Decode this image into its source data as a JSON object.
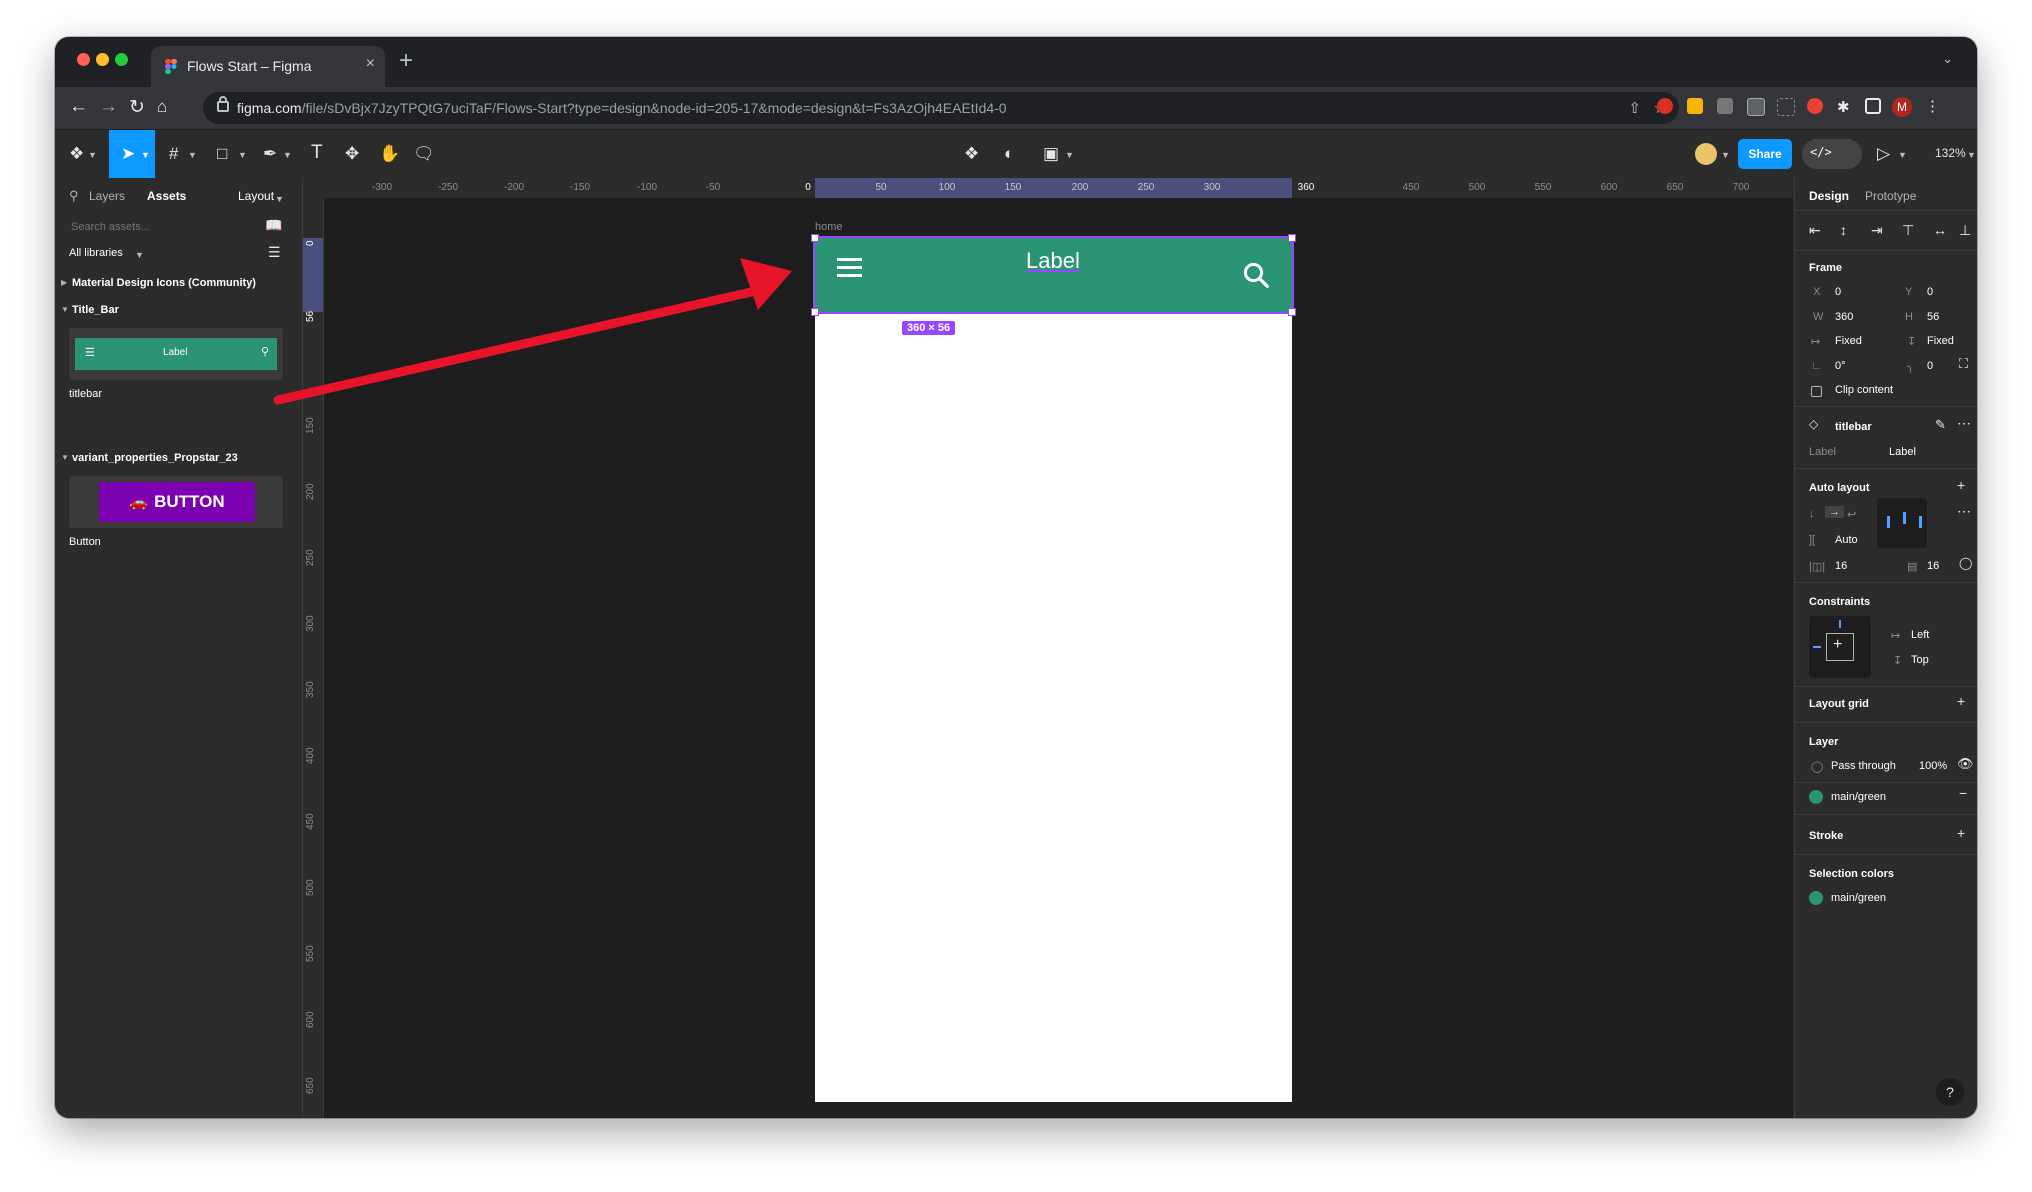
{
  "browser": {
    "tab_title": "Flows Start – Figma",
    "tab_close": "×",
    "new_tab": "+",
    "url_host": "figma.com",
    "url_path": "/file/sDvBjx7JzyTPQtG7uciTaF/Flows-Start?type=design&node-id=205-17&mode=design&t=Fs3AzOjh4EAEtId4-0",
    "profile_initial": "M"
  },
  "toolbar": {
    "share_label": "Share",
    "zoom": "132%"
  },
  "left_panel": {
    "tabs": [
      "Layers",
      "Assets"
    ],
    "layout_label": "Layout",
    "search_placeholder": "Search assets...",
    "libraries_label": "All libraries",
    "sections": [
      {
        "title": "Material Design Icons (Community)"
      },
      {
        "title": "Title_Bar",
        "component": "titlebar",
        "preview_label": "Label"
      },
      {
        "title": "variant_properties_Propstar_23",
        "component": "Button",
        "preview_label": "BUTTON"
      }
    ]
  },
  "rulers": {
    "h_ticks": [
      "-300",
      "-250",
      "-200",
      "-150",
      "-100",
      "-50",
      "0",
      "50",
      "100",
      "150",
      "200",
      "250",
      "300",
      "360",
      "450",
      "500",
      "550",
      "600",
      "650",
      "700"
    ],
    "v_ticks": [
      "0",
      "56",
      "150",
      "200",
      "250",
      "300",
      "350",
      "400",
      "450",
      "500",
      "550",
      "600",
      "650"
    ]
  },
  "canvas": {
    "frame_name": "home",
    "titlebar_label": "Label",
    "dimension_badge": "360 × 56"
  },
  "right_panel": {
    "tabs": [
      "Design",
      "Prototype"
    ],
    "frame_heading": "Frame",
    "x": "0",
    "y": "0",
    "w": "360",
    "h": "56",
    "horizontal_resizing": "Fixed",
    "vertical_resizing": "Fixed",
    "rotation": "0°",
    "corner_radius": "0",
    "clip_content": "Clip content",
    "component_name": "titlebar",
    "prop_name": "Label",
    "prop_value": "Label",
    "auto_layout_heading": "Auto layout",
    "spacing_mode": "Auto",
    "padding_h": "16",
    "padding_v": "16",
    "constraints_heading": "Constraints",
    "constraint_h": "Left",
    "constraint_v": "Top",
    "layout_grid_heading": "Layout grid",
    "layer_heading": "Layer",
    "blend_mode": "Pass through",
    "opacity": "100%",
    "fill_name": "main/green",
    "stroke_heading": "Stroke",
    "selection_colors_heading": "Selection colors",
    "selection_color_name": "main/green",
    "help": "?"
  },
  "colors": {
    "titlebar_green": "#2a9474",
    "selection_purple": "#9747ff",
    "accent_blue": "#0d99ff",
    "button_purple": "#7b00b0",
    "arrow_red": "#e8142a"
  }
}
